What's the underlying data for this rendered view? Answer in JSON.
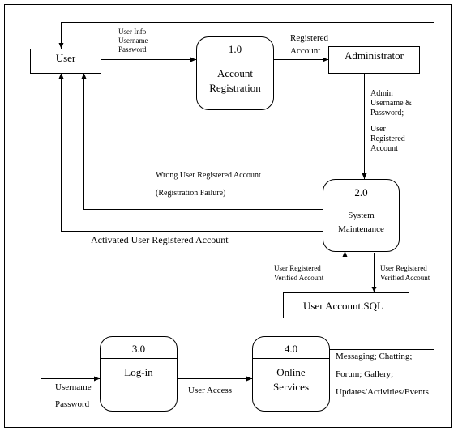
{
  "entities": {
    "user": "User",
    "administrator": "Administrator"
  },
  "processes": [
    {
      "id": "1.0",
      "name_line1": "Account",
      "name_line2": "Registration"
    },
    {
      "id": "2.0",
      "name_line1": "System",
      "name_line2": "Maintenance"
    },
    {
      "id": "3.0",
      "name_line1": "Log-in"
    },
    {
      "id": "4.0",
      "name_line1": "Online",
      "name_line2": "Services"
    }
  ],
  "data_store": "User Account.SQL",
  "flows": {
    "user_info": [
      "User Info",
      "Username",
      "Password"
    ],
    "registered_account": [
      "Registered",
      "Account"
    ],
    "admin_credentials": [
      "Admin",
      "Username &",
      "Password;"
    ],
    "user_registered_account": [
      "User",
      "Registered",
      "Account"
    ],
    "wrong_account": "Wrong User Registered Account",
    "registration_failure": "(Registration Failure)",
    "activated_account": "Activated User Registered Account",
    "verified_up": [
      "User Registered",
      "Verified Account"
    ],
    "verified_down": [
      "User Registered",
      "Verified Account"
    ],
    "login_credentials": [
      "Username",
      "Password"
    ],
    "user_access": "User Access",
    "services": [
      "Messaging;  Chatting;",
      "Forum;  Gallery;",
      "Updates/Activities/Events"
    ]
  }
}
